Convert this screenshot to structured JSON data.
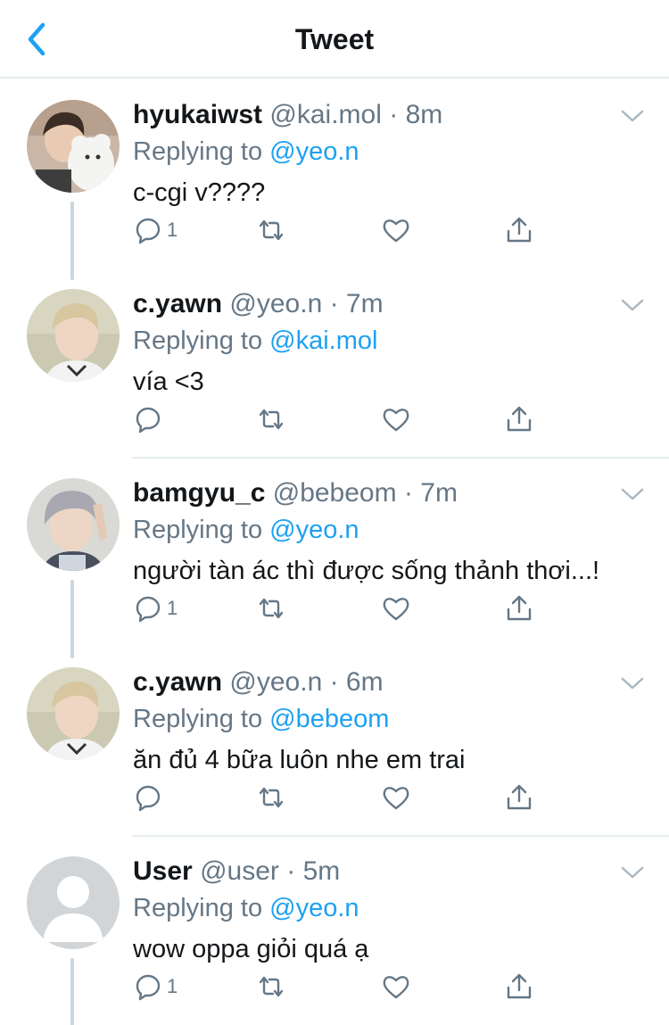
{
  "header": {
    "title": "Tweet"
  },
  "tweets": [
    {
      "name": "hyukaiwst",
      "handle": "@kai.mol",
      "time": "8m",
      "replying_label": "Replying to",
      "replying_to": "@yeo.n",
      "text": "c-cgi v????",
      "reply_count": "1",
      "avatar": "photo"
    },
    {
      "name": "c.yawn",
      "handle": "@yeo.n",
      "time": "7m",
      "replying_label": "Replying to",
      "replying_to": "@kai.mol",
      "text": "vía <3",
      "reply_count": "",
      "avatar": "photo"
    },
    {
      "name": "bamgyu_c",
      "handle": "@bebeom",
      "time": "7m",
      "replying_label": "Replying to",
      "replying_to": "@yeo.n",
      "text": "người tàn ác thì được sống thảnh thơi...!",
      "reply_count": "1",
      "avatar": "photo"
    },
    {
      "name": "c.yawn",
      "handle": "@yeo.n",
      "time": "6m",
      "replying_label": "Replying to",
      "replying_to": "@bebeom",
      "text": "ăn đủ 4 bữa luôn nhe em trai",
      "reply_count": "",
      "avatar": "photo"
    },
    {
      "name": "User",
      "handle": "@user",
      "time": "5m",
      "replying_label": "Replying to",
      "replying_to": "@yeo.n",
      "text": "wow oppa giỏi quá ạ",
      "reply_count": "1",
      "avatar": "default"
    }
  ],
  "colors": {
    "accent": "#1da1f2",
    "secondary_text": "#657786",
    "icon": "#657786",
    "divider": "#e6ecf0"
  },
  "icons": [
    "back-chevron-icon",
    "chevron-down-icon",
    "reply-icon",
    "retweet-icon",
    "like-icon",
    "share-icon"
  ]
}
